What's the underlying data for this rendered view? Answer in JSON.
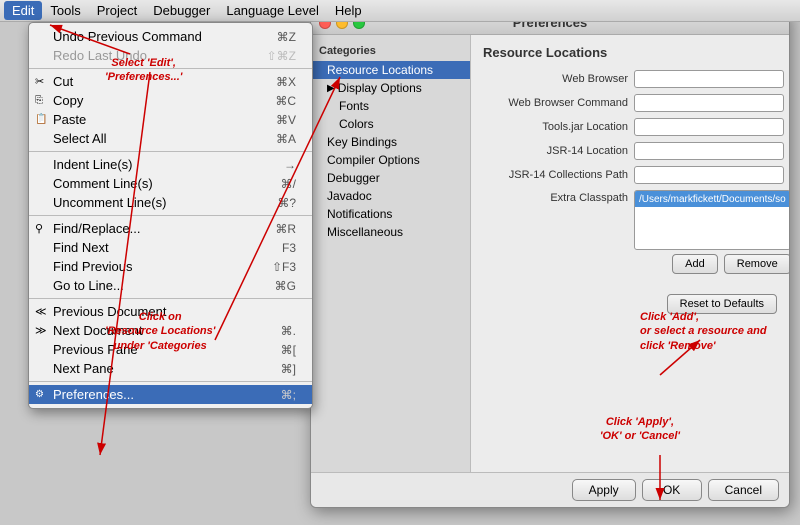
{
  "menubar": {
    "items": [
      "Edit",
      "Tools",
      "Project",
      "Debugger",
      "Language Level",
      "Help"
    ],
    "active": "Edit"
  },
  "dropdown": {
    "items": [
      {
        "label": "Undo Previous Command",
        "shortcut": "⌘Z",
        "disabled": false,
        "icon": "↩"
      },
      {
        "label": "Redo Last Undo",
        "shortcut": "⇧⌘Z",
        "disabled": true,
        "icon": "↪"
      },
      {
        "separator": true
      },
      {
        "label": "Cut",
        "shortcut": "⌘X",
        "disabled": false,
        "icon": "✂"
      },
      {
        "label": "Copy",
        "shortcut": "⌘C",
        "disabled": false,
        "icon": "⎘"
      },
      {
        "label": "Paste",
        "shortcut": "⌘V",
        "disabled": false,
        "icon": "📋"
      },
      {
        "label": "Select All",
        "shortcut": "⌘A",
        "disabled": false
      },
      {
        "separator": true
      },
      {
        "label": "Indent Line(s)",
        "shortcut": "→",
        "disabled": false
      },
      {
        "label": "Comment Line(s)",
        "shortcut": "⌘/",
        "disabled": false
      },
      {
        "label": "Uncomment Line(s)",
        "shortcut": "⌘?",
        "disabled": false
      },
      {
        "separator": true
      },
      {
        "label": "Find/Replace...",
        "shortcut": "⌘R",
        "disabled": false,
        "icon": "⚲"
      },
      {
        "label": "Find Next",
        "shortcut": "F3",
        "disabled": false
      },
      {
        "label": "Find Previous",
        "shortcut": "⇧F3",
        "disabled": false
      },
      {
        "label": "Go to Line...",
        "shortcut": "⌘G",
        "disabled": false
      },
      {
        "separator": true
      },
      {
        "label": "Previous Document",
        "shortcut": "",
        "disabled": false,
        "icon": "≪"
      },
      {
        "label": "Next Document",
        "shortcut": "⌘.",
        "disabled": false,
        "icon": "≫"
      },
      {
        "label": "Previous Pane",
        "shortcut": "⌘[",
        "disabled": false
      },
      {
        "label": "Next Pane",
        "shortcut": "⌘]",
        "disabled": false
      },
      {
        "separator": true
      },
      {
        "label": "Preferences...",
        "shortcut": "⌘;",
        "disabled": false,
        "highlighted": true,
        "icon": "⚙"
      }
    ]
  },
  "prefs": {
    "title": "Preferences",
    "categories_header": "Categories",
    "categories": [
      {
        "label": "Resource Locations",
        "selected": true,
        "level": 1,
        "hasArrow": false
      },
      {
        "label": "Display Options",
        "level": 1,
        "hasArrow": true
      },
      {
        "label": "Fonts",
        "level": 2
      },
      {
        "label": "Colors",
        "level": 2
      },
      {
        "label": "Key Bindings",
        "level": 1
      },
      {
        "label": "Compiler Options",
        "level": 1
      },
      {
        "label": "Debugger",
        "level": 1
      },
      {
        "label": "Javadoc",
        "level": 1
      },
      {
        "label": "Notifications",
        "level": 1
      },
      {
        "label": "Miscellaneous",
        "level": 1
      }
    ],
    "resource_header": "Resource Locations",
    "fields": [
      {
        "label": "Web Browser",
        "value": ""
      },
      {
        "label": "Web Browser Command",
        "value": ""
      },
      {
        "label": "Tools.jar Location",
        "value": ""
      },
      {
        "label": "JSR-14 Location",
        "value": ""
      },
      {
        "label": "JSR-14 Collections Path",
        "value": ""
      }
    ],
    "classpath_label": "Extra Classpath",
    "classpath_value": "/Users/markfickett/Documents/so",
    "buttons": {
      "add": "Add",
      "remove": "Remove",
      "reset": "Reset to Defaults"
    },
    "footer": {
      "apply": "Apply",
      "ok": "OK",
      "cancel": "Cancel"
    }
  },
  "annotations": {
    "select_edit": "Select 'Edit',\n'Preferences...'",
    "click_resource": "Click on\n'Resource Locations'\nunder 'Categories",
    "click_add": "Click 'Add',\nor select a resource and\nclick 'Remove'",
    "click_apply": "Click 'Apply',\n'OK' or 'Cancel'"
  }
}
